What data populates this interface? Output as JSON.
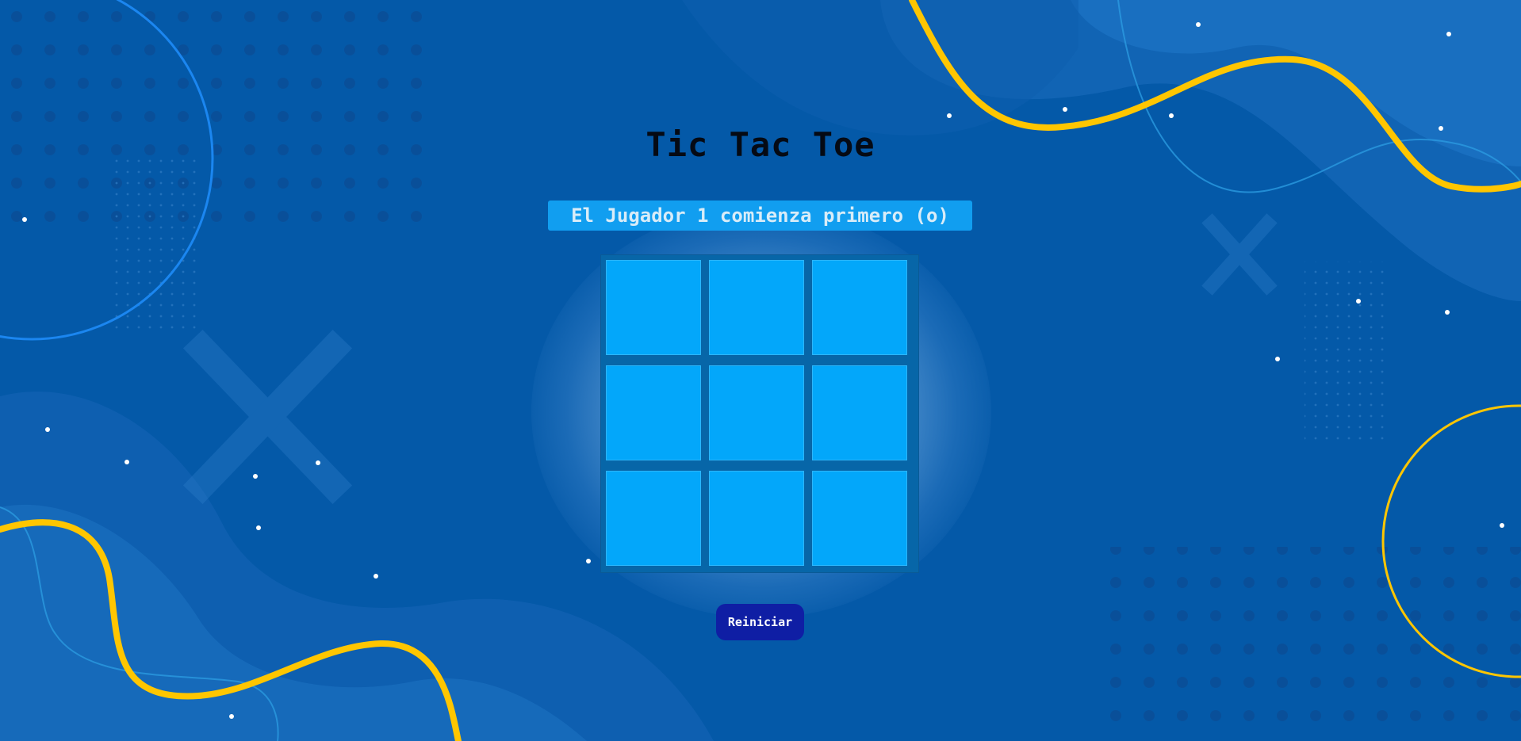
{
  "game": {
    "title": "Tic Tac Toe",
    "status": "El Jugador 1 comienza primero (o)",
    "board": [
      "",
      "",
      "",
      "",
      "",
      "",
      "",
      "",
      ""
    ],
    "restart_label": "Reiniciar"
  },
  "colors": {
    "background": "#0459a8",
    "cell": "#03a7fa",
    "board_frame": "#0766a8",
    "status_bg": "#119ef0",
    "button": "#0f1ea4",
    "accent_yellow": "#ffc600"
  }
}
